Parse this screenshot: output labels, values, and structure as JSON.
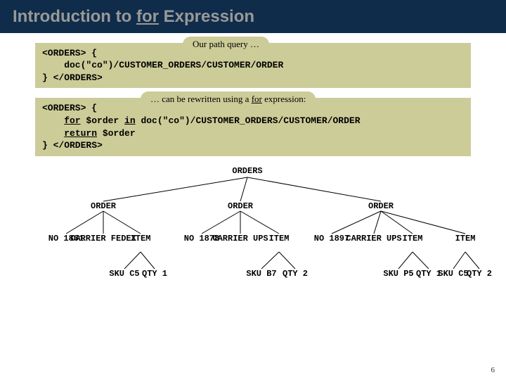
{
  "title_pre": "Introduction to ",
  "title_for": "for",
  "title_post": " Expression",
  "label1": "Our path query …",
  "code1": "<ORDERS> {\n    doc(\"co\")/CUSTOMER_ORDERS/CUSTOMER/ORDER\n} </ORDERS>",
  "label2_pre": "… can be rewritten using a ",
  "label2_for": "for",
  "label2_post": " expression:",
  "code2a": "<ORDERS> {",
  "code2b_for": "for",
  "code2b_mid": " $order ",
  "code2b_in": "in",
  "code2b_rest": " doc(\"co\")/CUSTOMER_ORDERS/CUSTOMER/ORDER",
  "code2c_ret": "return",
  "code2c_rest": " $order",
  "code2d": "} </ORDERS>",
  "tree": {
    "root": "ORDERS",
    "n1": "ORDER",
    "n2": "ORDER",
    "n3": "ORDER",
    "no1": "NO\n1861",
    "car1": "CARRIER\nFEDEX",
    "it1": "ITEM",
    "sku1": "SKU\nC5",
    "qty1": "QTY\n1",
    "no2": "NO\n1878",
    "car2": "CARRIER\nUPS",
    "it2": "ITEM",
    "sku2": "SKU\nB7",
    "qty2": "QTY\n2",
    "no3": "NO\n1897",
    "car3": "CARRIER\nUPS",
    "it3a": "ITEM",
    "it3b": "ITEM",
    "sku3a": "SKU\nP5",
    "qty3a": "QTY\n1",
    "sku3b": "SKU\nC5",
    "qty3b": "QTY\n2"
  },
  "pagenum": "6"
}
